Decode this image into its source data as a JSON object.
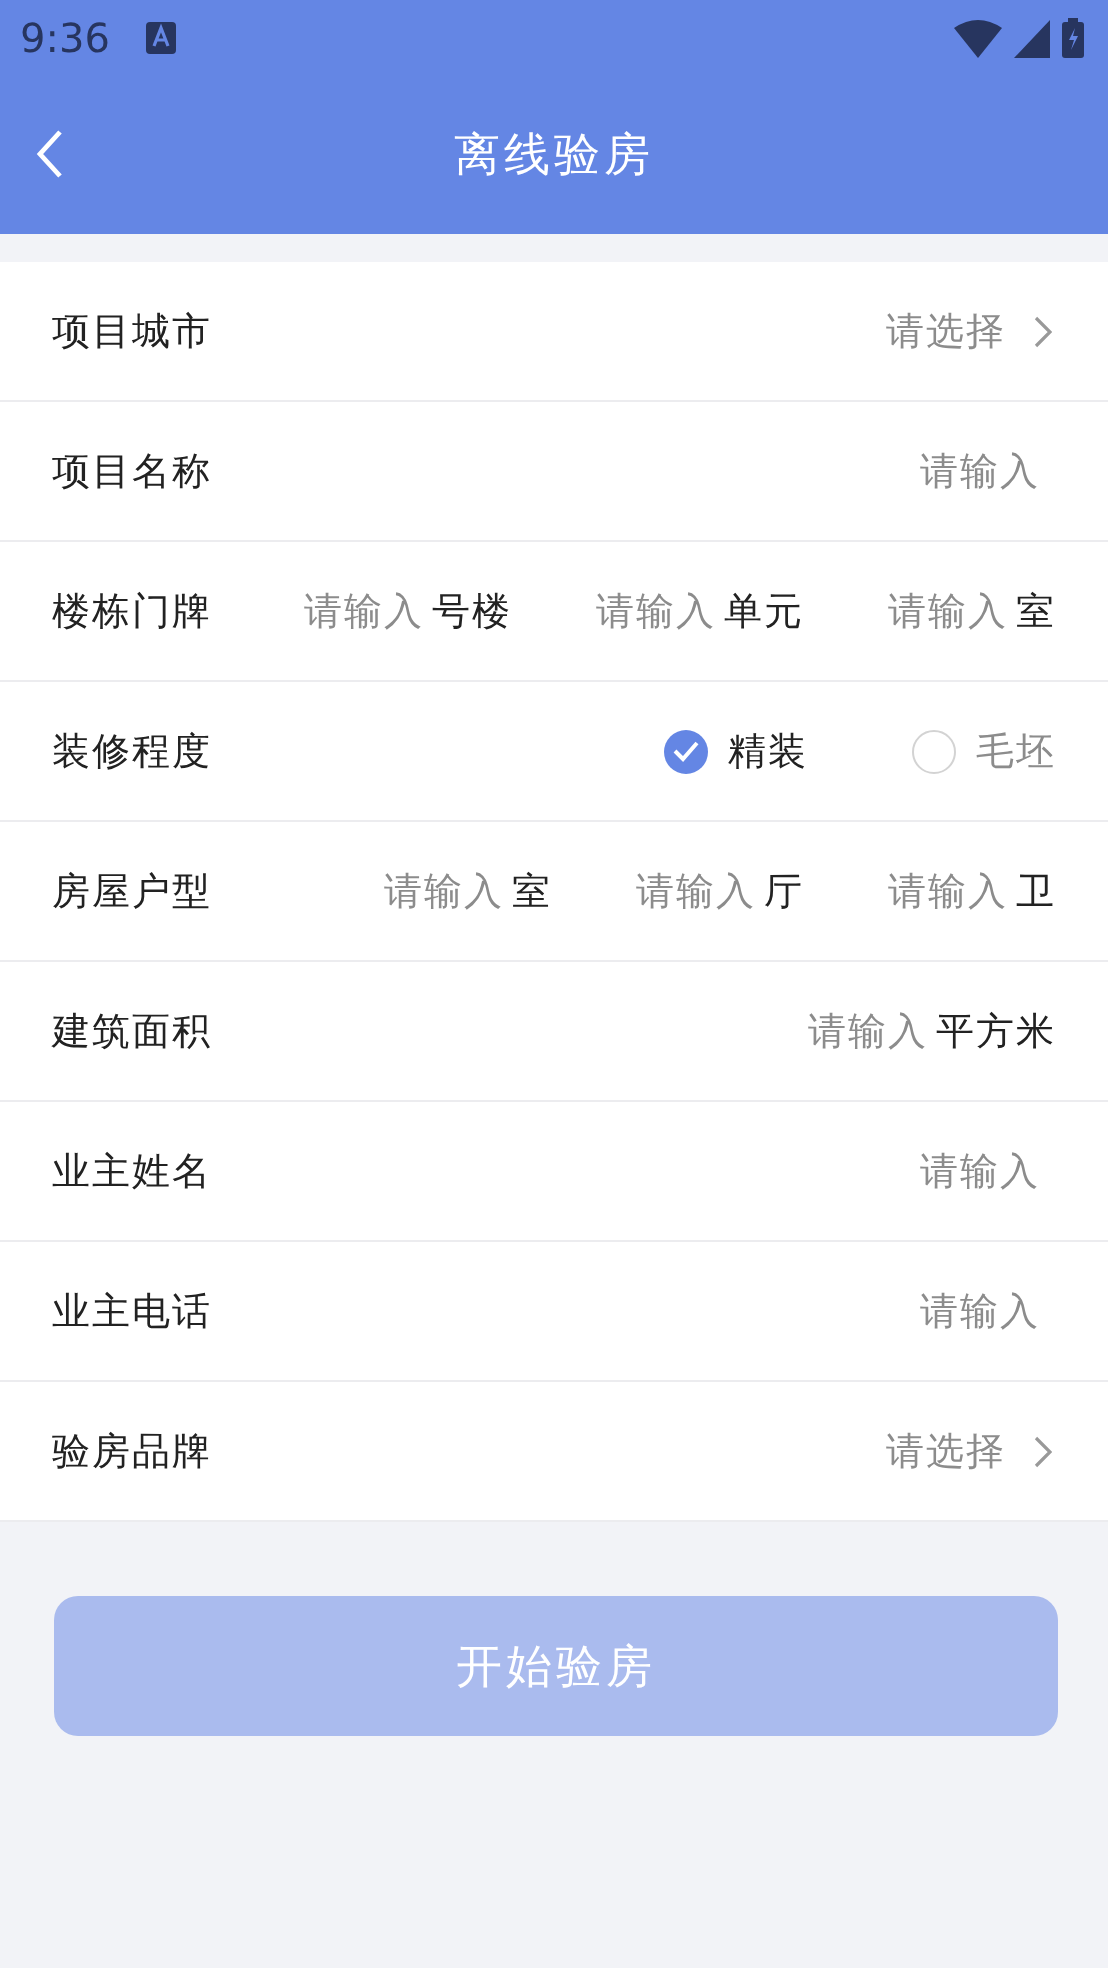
{
  "status_bar": {
    "time": "9:36"
  },
  "app_bar": {
    "title": "离线验房"
  },
  "form": [
    {
      "kind": "select",
      "label": "项目城市",
      "hint": "请选择"
    },
    {
      "kind": "input",
      "label": "项目名称",
      "placeholder": "请输入"
    },
    {
      "kind": "multi",
      "label": "楼栋门牌",
      "parts": [
        {
          "placeholder": "请输入",
          "unit": "号楼"
        },
        {
          "placeholder": "请输入",
          "unit": "单元"
        },
        {
          "placeholder": "请输入",
          "unit": "室"
        }
      ]
    },
    {
      "kind": "radio",
      "label": "装修程度",
      "options": [
        {
          "label": "精装",
          "selected": true
        },
        {
          "label": "毛坯",
          "selected": false
        }
      ]
    },
    {
      "kind": "multi",
      "label": "房屋户型",
      "parts": [
        {
          "placeholder": "请输入",
          "unit": "室"
        },
        {
          "placeholder": "请输入",
          "unit": "厅"
        },
        {
          "placeholder": "请输入",
          "unit": "卫"
        }
      ]
    },
    {
      "kind": "multi",
      "label": "建筑面积",
      "parts": [
        {
          "placeholder": "请输入",
          "unit": "平方米"
        }
      ]
    },
    {
      "kind": "input",
      "label": "业主姓名",
      "placeholder": "请输入"
    },
    {
      "kind": "input",
      "label": "业主电话",
      "placeholder": "请输入"
    },
    {
      "kind": "select",
      "label": "验房品牌",
      "hint": "请选择"
    }
  ],
  "submit_button": {
    "label": "开始验房",
    "disabled": true
  }
}
